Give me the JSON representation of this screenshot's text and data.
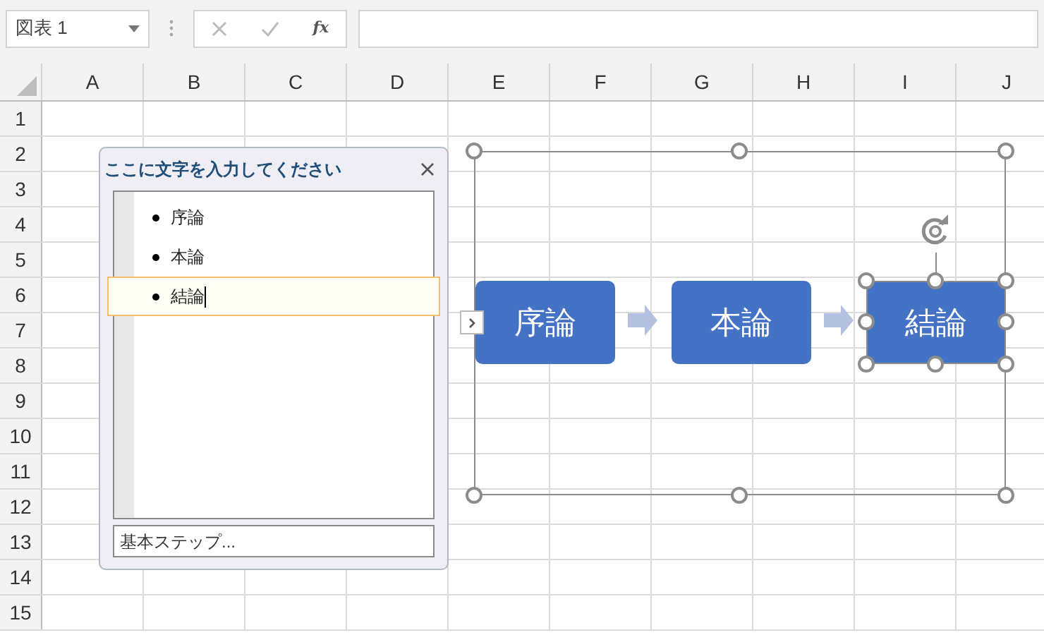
{
  "name_box": {
    "value": "図表 1"
  },
  "formula_bar": {
    "function_label": "fx"
  },
  "columns": [
    "A",
    "B",
    "C",
    "D",
    "E",
    "F",
    "G",
    "H",
    "I",
    "J"
  ],
  "rows": [
    "1",
    "2",
    "3",
    "4",
    "5",
    "6",
    "7",
    "8",
    "9",
    "10",
    "11",
    "12",
    "13",
    "14",
    "15"
  ],
  "text_pane": {
    "title": "ここに文字を入力してください",
    "items": [
      {
        "text": "序論",
        "selected": false
      },
      {
        "text": "本論",
        "selected": false
      },
      {
        "text": "結論",
        "selected": true
      }
    ],
    "footer": "基本ステップ..."
  },
  "smartart": {
    "shapes": [
      {
        "text": "序論",
        "selected": false
      },
      {
        "text": "本論",
        "selected": false
      },
      {
        "text": "結論",
        "selected": true
      }
    ]
  }
}
